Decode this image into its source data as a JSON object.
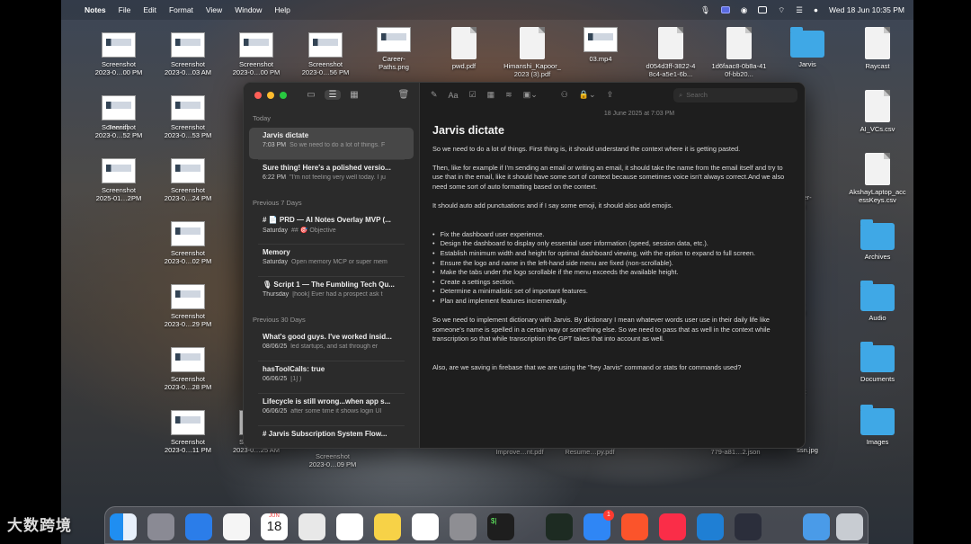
{
  "menubar": {
    "app": "Notes",
    "items": [
      "File",
      "Edit",
      "Format",
      "View",
      "Window",
      "Help"
    ],
    "clock": "Wed 18 Jun  10:35 PM"
  },
  "desktop": {
    "icons": [
      {
        "label": "Screenshot\n2023-0…00 PM",
        "kind": "thumb"
      },
      {
        "label": "Screenshot\n2023-0…03 AM",
        "kind": "thumb"
      },
      {
        "label": "Screenshot\n2023-0…00 PM",
        "kind": "thumb"
      },
      {
        "label": "Screenshot\n2023-0…56 PM",
        "kind": "thumb"
      },
      {
        "label": "Career-\nPaths.png",
        "kind": "thumb"
      },
      {
        "label": "pwd.pdf",
        "kind": "doc"
      },
      {
        "label": "Himanshi_Kapoor_\n2023 (3).pdf",
        "kind": "doc"
      },
      {
        "label": "03.mp4",
        "kind": "thumb"
      },
      {
        "label": "d054d3ff-3822-4\n8c4-a5e1-6b...",
        "kind": "doc"
      },
      {
        "label": "1d6faac8-0b8a-41\n0f-bb20...",
        "kind": "doc"
      },
      {
        "label": "Jarvis",
        "kind": "folder"
      },
      {
        "label": "Raycast",
        "kind": "doc"
      },
      {
        "label": "Saasify",
        "kind": "thumb"
      },
      {
        "label": "Screenshot\n2023-0…53 PM",
        "kind": "thumb"
      },
      {
        "label": "Screenshot\n2023-0…52 PM",
        "kind": "thumb"
      },
      {
        "label": "AI_VCs.csv",
        "kind": "doc"
      },
      {
        "label": "Screenshot\n2025-01…2PM",
        "kind": "thumb"
      },
      {
        "label": "Screenshot\n2023-0…24 PM",
        "kind": "thumb"
      },
      {
        "label": "AkshayLaptop_acc\nessKeys.csv",
        "kind": "doc"
      },
      {
        "label": "Screenshot\n2023-0…02 PM",
        "kind": "thumb"
      },
      {
        "label": "Archives",
        "kind": "folder"
      },
      {
        "label": "Screenshot\n2023-0…29 PM",
        "kind": "thumb"
      },
      {
        "label": "Audio",
        "kind": "folder"
      },
      {
        "label": "Screenshot\n2023-0…28 PM",
        "kind": "thumb"
      },
      {
        "label": "Documents",
        "kind": "folder"
      },
      {
        "label": "Screenshot\n2023-0…11 PM",
        "kind": "thumb"
      },
      {
        "label": "Screenshot\n2023-0…25 AM",
        "kind": "thumb"
      },
      {
        "label": "Images",
        "kind": "folder"
      }
    ],
    "peek_labels": [
      "browser-\nf.pkg",
      "hoto\n.jpeg",
      "sport\njpg",
      "ssn.jpg",
      "Improve…nt.pdf",
      "Resume…py.pdf",
      "779-a81…2.json",
      "Screenshot\n2023-0…09 PM"
    ]
  },
  "notes_app": {
    "search_placeholder": "Search",
    "sections": [
      {
        "header": "Today",
        "notes": [
          {
            "title": "Jarvis dictate",
            "time": "7:03 PM",
            "preview": "So we need to do a lot of things. F"
          },
          {
            "title": "Sure thing! Here's a polished versio...",
            "time": "6:22 PM",
            "preview": "\"I'm not feeling very well today. I ju"
          }
        ]
      },
      {
        "header": "Previous 7 Days",
        "notes": [
          {
            "title": "# 📄 PRD — AI Notes Overlay MVP (...",
            "time": "Saturday",
            "preview": "## 🎯 Objective"
          },
          {
            "title": "Memory",
            "time": "Saturday",
            "preview": "Open memory MCP or super mem"
          },
          {
            "title": "🎙 Script 1 — The Fumbling Tech Qu...",
            "time": "Thursday",
            "preview": "[hook] Ever had a prospect ask t"
          }
        ]
      },
      {
        "header": "Previous 30 Days",
        "notes": [
          {
            "title": "What's good guys. I've worked insid...",
            "time": "08/06/25",
            "preview": "led startups, and sat through er"
          },
          {
            "title": "hasToolCalls: true",
            "time": "06/06/25",
            "preview": "[1] )"
          },
          {
            "title": "Lifecycle is still wrong...when app s...",
            "time": "06/06/25",
            "preview": "after some time it shows login UI"
          },
          {
            "title": "# Jarvis Subscription System Flow...",
            "time": "",
            "preview": ""
          }
        ]
      }
    ],
    "editor": {
      "date": "18 June 2025 at 7:03 PM",
      "title": "Jarvis dictate",
      "p1": "So we need to do a lot of things. First thing is, it should understand the context where it is getting pasted.",
      "p2": "Then, like for example if I'm sending an email or writing an email, it should take the name from the email itself and try to use that in the email, like it should have some sort of context because sometimes voice isn't always correct.And we also need some sort of auto formatting based on the context.",
      "p3": "It should auto add punctuations and if I say some emoji, it should also add emojis.",
      "bullets": [
        "Fix the dashboard user experience.",
        "Design the dashboard to display only essential user information (speed, session data, etc.).",
        "Establish minimum width and height for optimal dashboard viewing, with the option to expand to full screen.",
        "Ensure the logo and name in the left-hand side menu are fixed (non-scrollable).",
        "Make the tabs under the logo scrollable if the menu exceeds the available height.",
        "Create a settings section.",
        "Determine a minimalistic set of important features.",
        "Plan and implement features incrementally."
      ],
      "p4": "So we need to implement dictionary with Jarvis. By dictionary I mean whatever words user use in their daily life like someone's name is spelled in a certain way or something else. So we need to pass that as well in the context while transcription so that while transcription the GPT takes that into account as well.",
      "p5": "Also, are we saving in firebase that we are using the \"hey Jarvis\" command or stats for commands used?"
    }
  },
  "dock": {
    "calendar_month": "JUN",
    "calendar_day": "18",
    "mail_badge": "1",
    "apps": [
      "finder",
      "launchpad",
      "safari",
      "photos",
      "calendar",
      "chrome",
      "reminders",
      "notes",
      "freeform",
      "settings",
      "terminal",
      "activity-monitor",
      "mail",
      "brave",
      "music",
      "vscode",
      "electron",
      "downloads",
      "trash"
    ]
  },
  "watermark": "大数跨境",
  "colors": {
    "accent": "#5a6be0",
    "note_selected": "#474747",
    "folder": "#3fa8e6",
    "badge": "#ff3b30"
  }
}
